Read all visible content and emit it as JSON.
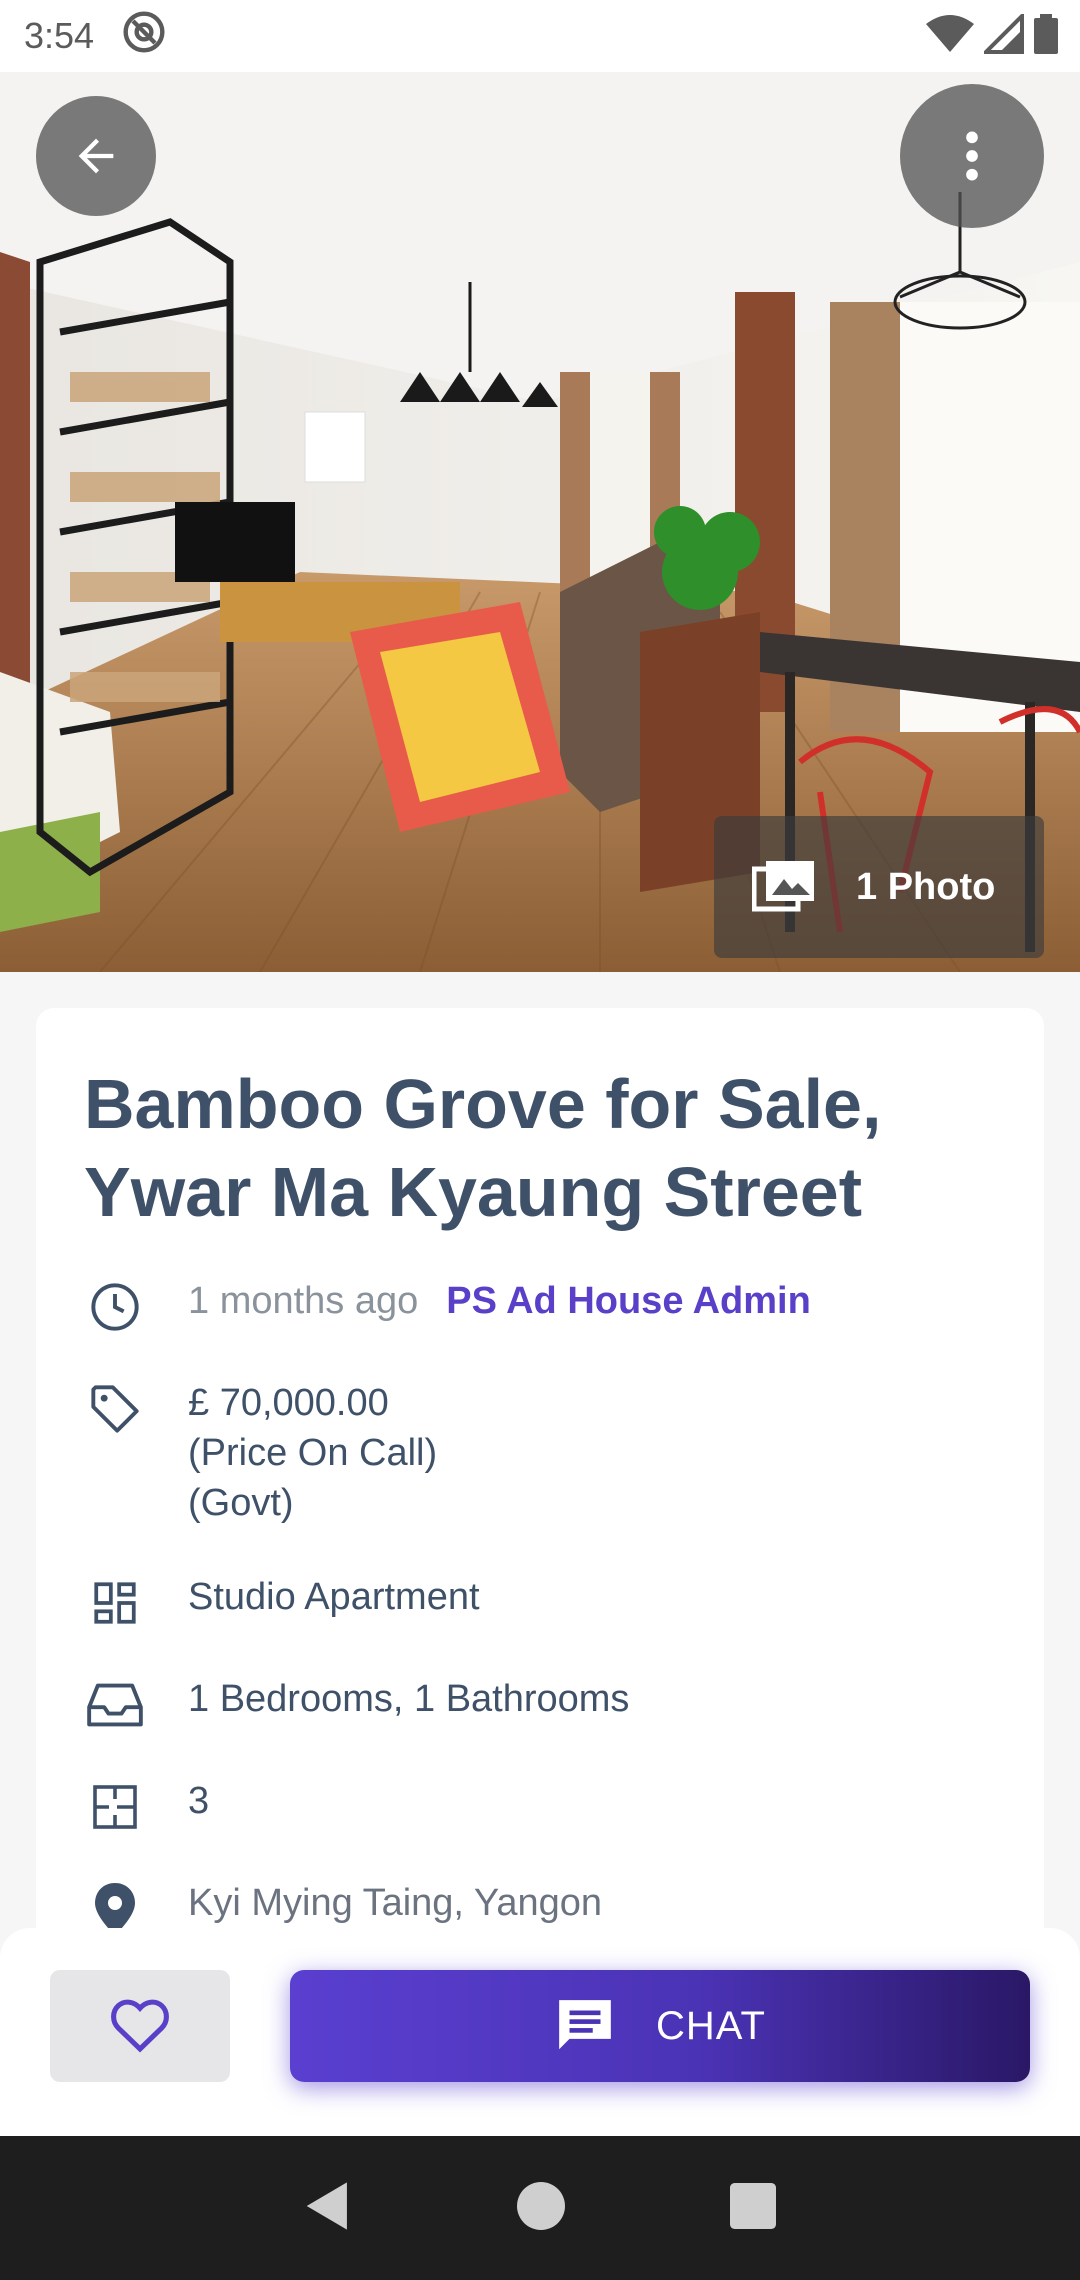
{
  "status_bar": {
    "time": "3:54"
  },
  "hero": {
    "photo_count_label": "1 Photo"
  },
  "listing": {
    "title": "Bamboo Grove for Sale, Ywar Ma Kyaung Street",
    "posted": "1 months ago",
    "author": "PS Ad House Admin",
    "price": "£ 70,000.00",
    "price_note": "(Price On Call)",
    "price_type": "(Govt)",
    "property_type": "Studio Apartment",
    "rooms": "1 Bedrooms, 1 Bathrooms",
    "floor": "3",
    "location": "Kyi Mying Taing, Yangon"
  },
  "actions": {
    "chat_label": "CHAT"
  },
  "colors": {
    "accent": "#5a3fc8",
    "title": "#3f5168",
    "muted": "#8a929c"
  },
  "icons": [
    "back-arrow-icon",
    "more-vert-icon",
    "photos-icon",
    "clock-icon",
    "tag-icon",
    "dashboard-icon",
    "inbox-icon",
    "floor-plan-icon",
    "location-pin-icon",
    "heart-icon",
    "chat-bubble-icon"
  ]
}
